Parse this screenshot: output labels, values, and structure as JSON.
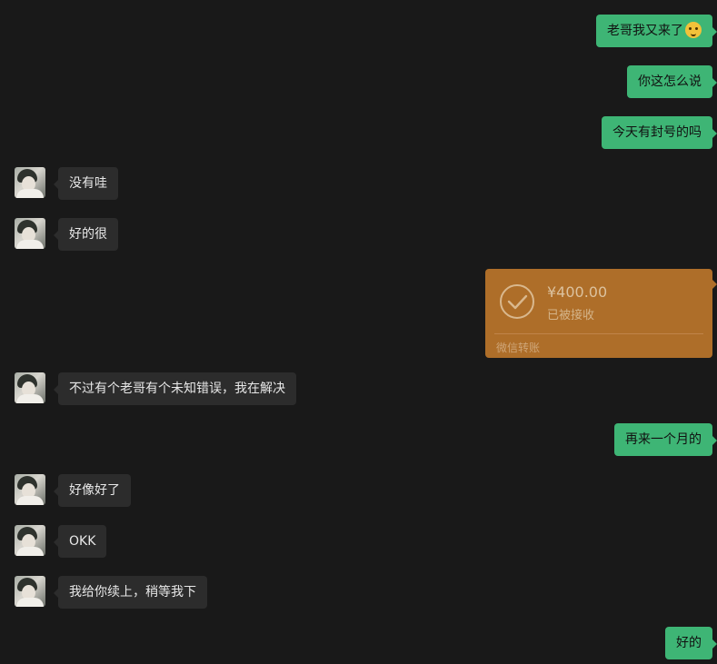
{
  "messages": [
    {
      "side": "out",
      "text": "老哥我又来了",
      "emoji": "cat-face-emoji"
    },
    {
      "side": "out",
      "text": "你这怎么说"
    },
    {
      "side": "out",
      "text": "今天有封号的吗"
    },
    {
      "side": "in",
      "text": "没有哇"
    },
    {
      "side": "in",
      "text": "好的很"
    },
    {
      "side": "in",
      "text": "不过有个老哥有个未知错误，我在解决"
    },
    {
      "side": "out",
      "text": "再来一个月的"
    },
    {
      "side": "in",
      "text": "好像好了"
    },
    {
      "side": "in",
      "text": "OKK"
    },
    {
      "side": "in",
      "text": "我给你续上，稍等我下"
    },
    {
      "side": "out",
      "text": "好的"
    }
  ],
  "transfer": {
    "amount": "¥400.00",
    "status": "已被接收",
    "footer": "微信转账",
    "icon": "check-circle-icon"
  },
  "colors": {
    "background": "#191919",
    "outgoing_bubble": "#3eb575",
    "incoming_bubble": "#2c2c2c",
    "transfer_card": "#ae6e29"
  }
}
